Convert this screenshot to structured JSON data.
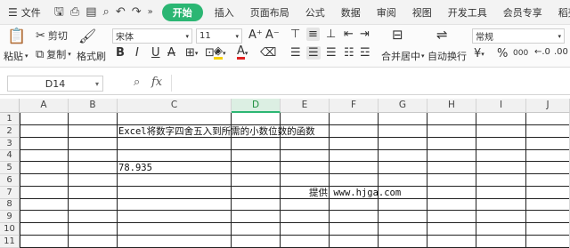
{
  "menubar": {
    "file_label": "文件",
    "tabs": [
      "开始",
      "插入",
      "页面布局",
      "公式",
      "数据",
      "审阅",
      "视图",
      "开发工具",
      "会员专享",
      "稻壳资源"
    ]
  },
  "ribbon": {
    "paste_label": "粘贴",
    "cut_label": "剪切",
    "copy_label": "复制",
    "format_painter_label": "格式刷",
    "font_name": "宋体",
    "font_size": "11",
    "merge_label": "合并居中",
    "wrap_label": "自动换行",
    "number_format": "常规",
    "currency_symbol": "¥",
    "percent_symbol": "%",
    "thousands_symbol": "000"
  },
  "formula_bar": {
    "name_box": "D14",
    "fx_label": "fx",
    "content": ""
  },
  "sheet": {
    "selected_column": "D",
    "columns": [
      "A",
      "B",
      "C",
      "D",
      "E",
      "F",
      "G",
      "H",
      "I",
      "J"
    ],
    "rows": [
      "1",
      "2",
      "3",
      "4",
      "5",
      "6",
      "7",
      "8",
      "9",
      "10",
      "11"
    ],
    "cells": {
      "C2": "Excel将数字四舍五入到所需的小数位数的函数",
      "C5": "78.935",
      "E7": "提供 www.hjga.com"
    }
  }
}
